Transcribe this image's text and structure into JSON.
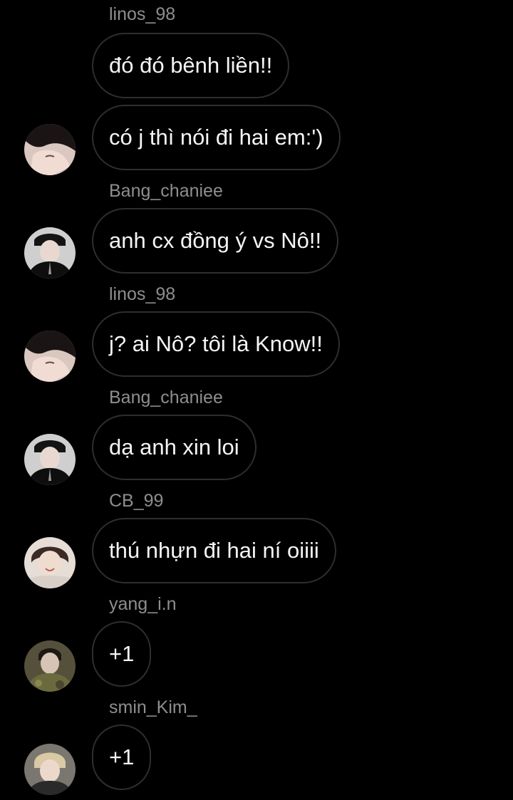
{
  "messages": [
    {
      "sender": "linos_98",
      "text": "đó đó bênh liền!!",
      "avatar": "none"
    },
    {
      "sender": "",
      "text": "có j thì nói đi hai em:')",
      "avatar": "avatar-linos"
    },
    {
      "sender": "Bang_chaniee",
      "text": "anh cx đồng ý vs Nô!!",
      "avatar": "avatar-bang"
    },
    {
      "sender": "linos_98",
      "text": "j? ai Nô? tôi là Know!!",
      "avatar": "avatar-linos"
    },
    {
      "sender": "Bang_chaniee",
      "text": "dạ anh xin loi",
      "avatar": "avatar-bang"
    },
    {
      "sender": "CB_99",
      "text": "thú nhựn đi hai ní oiiii",
      "avatar": "avatar-cb"
    },
    {
      "sender": "yang_i.n",
      "text": "+1",
      "avatar": "avatar-yang"
    },
    {
      "sender": "smin_Kim_",
      "text": "+1",
      "avatar": "avatar-smin"
    }
  ],
  "colors": {
    "background": "#000000",
    "bubble_border": "#2e2e2e",
    "sender_text": "#8e8e8e",
    "message_text": "#f5f5f5"
  }
}
